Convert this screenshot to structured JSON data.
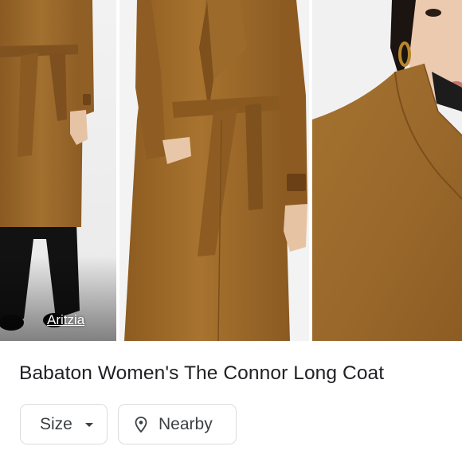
{
  "images": [
    {
      "alt": "Coat front view with belt and black trousers"
    },
    {
      "alt": "Model wearing belted camel coat"
    },
    {
      "alt": "Close-up of coat collar"
    }
  ],
  "source": {
    "label": "Aritzia"
  },
  "product": {
    "title": "Babaton Women's The Connor Long Coat"
  },
  "filters": {
    "size_label": "Size",
    "nearby_label": "Nearby"
  },
  "colors": {
    "coat": "#9b6a2c",
    "text": "#202124",
    "chip_border": "#dadce0"
  },
  "icons": {
    "size_caret": "caret-down-icon",
    "nearby_pin": "location-pin-icon"
  }
}
